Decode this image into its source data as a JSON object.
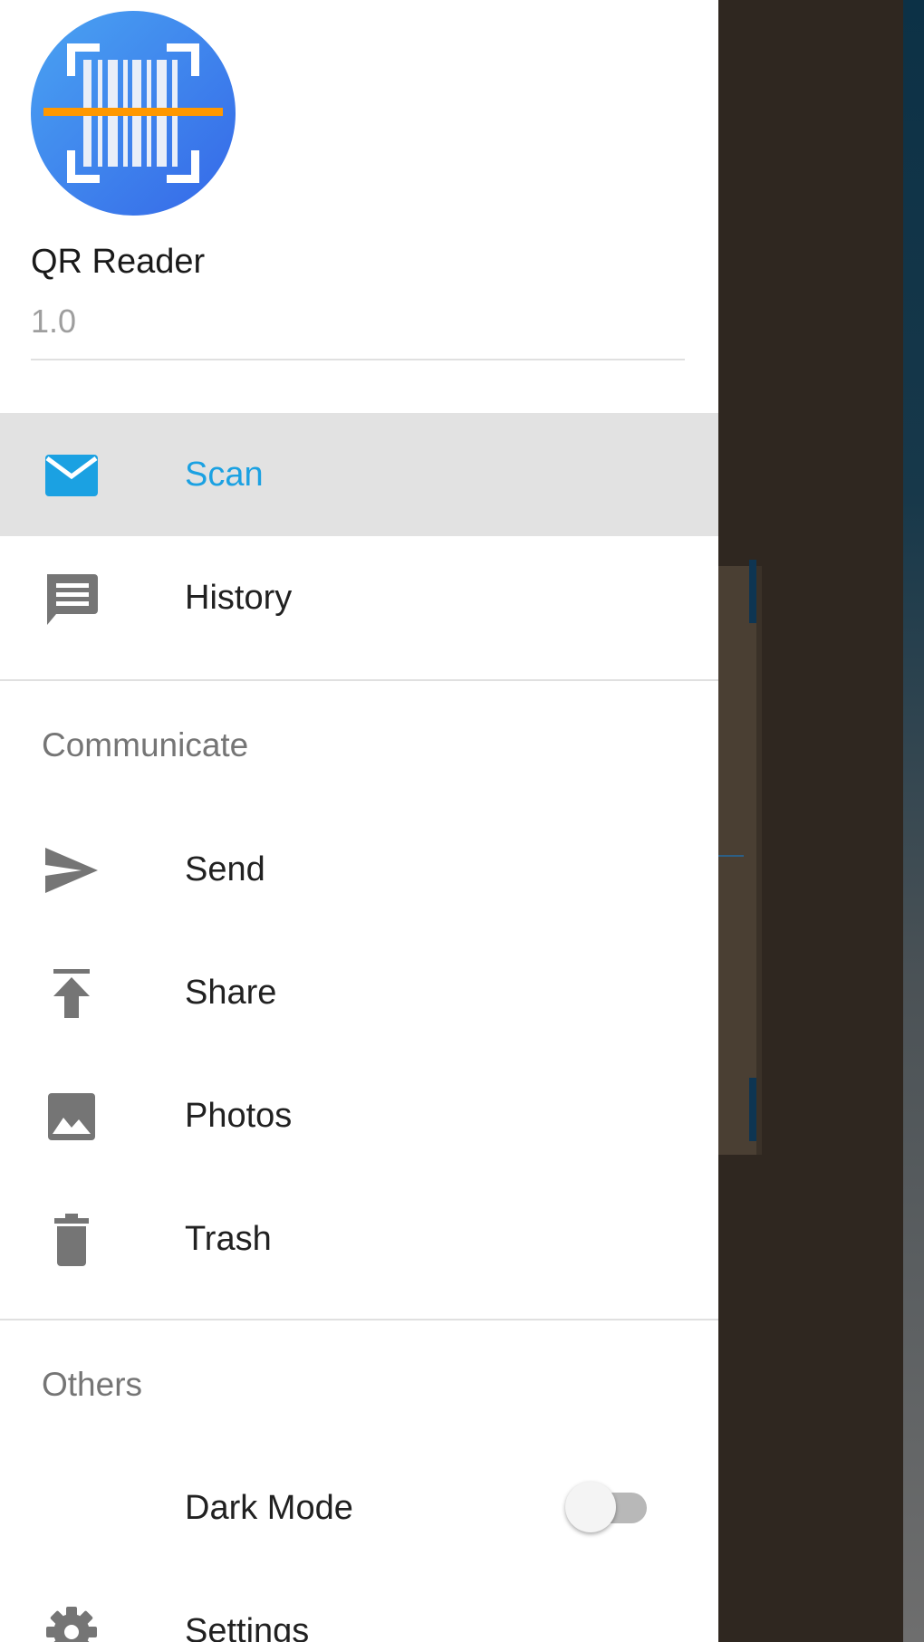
{
  "app": {
    "name": "QR Reader",
    "version": "1.0",
    "logo_icon": "barcode-scanner-logo",
    "logo_colors": {
      "circle": "#3f8cf0",
      "scan_line": "#ff9800"
    }
  },
  "menu": {
    "primary": [
      {
        "label": "Scan",
        "icon": "mail-icon",
        "active": true
      },
      {
        "label": "History",
        "icon": "chat-bubble-icon",
        "active": false
      }
    ],
    "communicate": {
      "title": "Communicate",
      "items": [
        {
          "label": "Send",
          "icon": "send-icon"
        },
        {
          "label": "Share",
          "icon": "upload-icon"
        },
        {
          "label": "Photos",
          "icon": "image-icon"
        },
        {
          "label": "Trash",
          "icon": "trash-icon"
        }
      ]
    },
    "others": {
      "title": "Others",
      "items": [
        {
          "label": "Dark Mode",
          "icon": "moon-icon",
          "toggle": false
        },
        {
          "label": "Settings",
          "icon": "gear-icon"
        }
      ]
    }
  },
  "colors": {
    "accent": "#1ba1e2",
    "active_bg": "#e2e2e2",
    "icon": "#757575",
    "text": "#212121",
    "section_text": "#757575"
  }
}
